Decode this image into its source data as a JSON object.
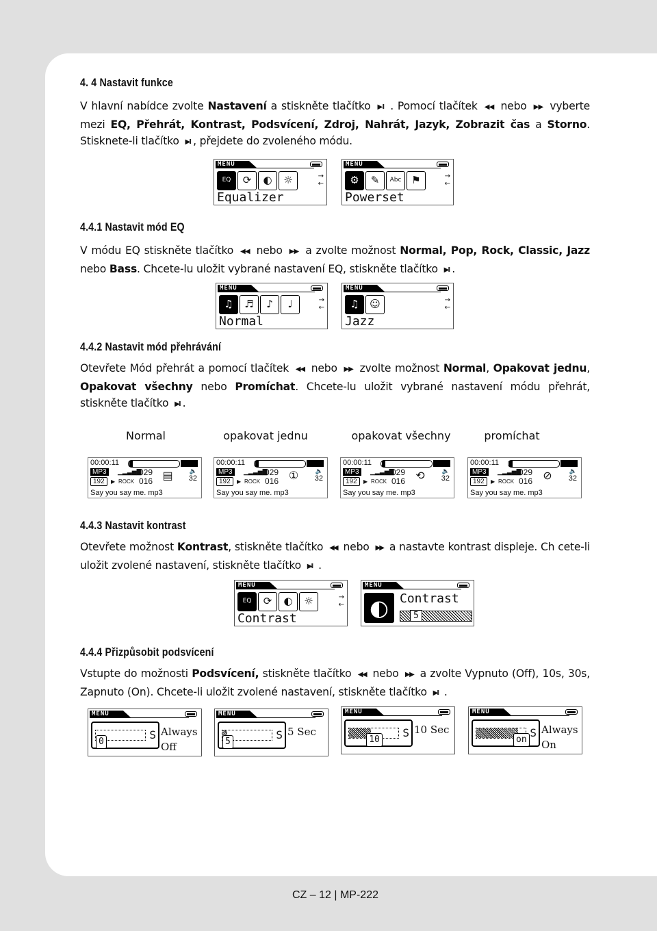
{
  "sections": [
    {
      "id": "s44",
      "heading": "4. 4 Nastavit funkce",
      "paragraph": [
        {
          "t": "V hlavní nabídce zvolte "
        },
        {
          "t": "Nastavení",
          "b": true
        },
        {
          "t": " a stiskněte tlačítko "
        },
        {
          "icon": "play-pause-icon",
          "g": "▶II"
        },
        {
          "t": " . Pomocí tlačítek "
        },
        {
          "icon": "rewind-icon",
          "g": "◀◀"
        },
        {
          "t": " nebo "
        },
        {
          "icon": "fast-forward-icon",
          "g": "▶▶"
        },
        {
          "t": " vyberte mezi "
        },
        {
          "t": "EQ, Přehrát, Kontrast, Podsvícení, Zdroj, Nahrát, Jazyk, Zobrazit čas",
          "b": true
        },
        {
          "t": " a "
        },
        {
          "t": "Storno",
          "b": true
        },
        {
          "t": ". Stisknete-li tlačítko "
        },
        {
          "icon": "play-pause-icon",
          "g": "▶II"
        },
        {
          "t": ", přejdete do zvoleného módu."
        }
      ]
    },
    {
      "id": "s441",
      "heading": "4.4.1 Nastavit mód EQ",
      "paragraph": [
        {
          "t": "V módu EQ stiskněte tlačítko "
        },
        {
          "icon": "rewind-icon",
          "g": "◀◀"
        },
        {
          "t": " nebo "
        },
        {
          "icon": "fast-forward-icon",
          "g": "▶▶"
        },
        {
          "t": " a zvolte možnost "
        },
        {
          "t": "Normal, Pop, Rock, Classic, Jazz",
          "b": true
        },
        {
          "t": " nebo "
        },
        {
          "t": "Bass",
          "b": true
        },
        {
          "t": ". Chcete-lu uložit vybrané nastavení EQ, stiskněte tlačítko "
        },
        {
          "icon": "play-pause-icon",
          "g": "▶II"
        },
        {
          "t": "."
        }
      ]
    },
    {
      "id": "s442",
      "heading": "4.4.2 Nastavit mód přehrávání",
      "paragraph": [
        {
          "t": "Otevřete Mód přehrát a pomocí tlačítek "
        },
        {
          "icon": "rewind-icon",
          "g": "◀◀"
        },
        {
          "t": " nebo "
        },
        {
          "icon": "fast-forward-icon",
          "g": "▶▶"
        },
        {
          "t": " zvolte možnost "
        },
        {
          "t": "Normal",
          "b": true
        },
        {
          "t": ", "
        },
        {
          "t": "Opakovat jednu",
          "b": true
        },
        {
          "t": ", "
        },
        {
          "t": "Opakovat všechny",
          "b": true
        },
        {
          "t": " nebo "
        },
        {
          "t": "Promíchat",
          "b": true
        },
        {
          "t": ". Chcete-lu uložit vybrané nastavení módu přehrát, stiskněte tlačítko "
        },
        {
          "icon": "play-pause-icon",
          "g": "▶II"
        },
        {
          "t": "."
        }
      ]
    },
    {
      "id": "s443",
      "heading": "4.4.3 Nastavit kontrast",
      "paragraph": [
        {
          "t": "Otevřete možnost "
        },
        {
          "t": "Kontrast",
          "b": true
        },
        {
          "t": ", stiskněte tlačítko "
        },
        {
          "icon": "rewind-icon",
          "g": "◀◀"
        },
        {
          "t": " nebo "
        },
        {
          "icon": "fast-forward-icon",
          "g": "▶▶"
        },
        {
          "t": " a nastavte kontrast displeje. Ch cete-li uložit zvolené nastavení, stiskněte tlačítko "
        },
        {
          "icon": "play-pause-icon",
          "g": "▶II"
        },
        {
          "t": " ."
        }
      ]
    },
    {
      "id": "s444",
      "heading": "4.4.4 Přizpůsobit podsvícení",
      "paragraph": [
        {
          "t": "Vstupte do možnosti "
        },
        {
          "t": "Podsvícení,",
          "b": true
        },
        {
          "t": " stiskněte tlačítko "
        },
        {
          "icon": "rewind-icon",
          "g": "◀◀"
        },
        {
          "t": " nebo "
        },
        {
          "icon": "fast-forward-icon",
          "g": "▶▶"
        },
        {
          "t": " a zvolte Vypnuto (Off), 10s, 30s, Zapnuto (On). Chcete-li uložit zvolené nastavení, stiskněte tlačítko "
        },
        {
          "icon": "play-pause-icon",
          "g": "▶II"
        },
        {
          "t": " ."
        }
      ]
    }
  ],
  "menu_screens": [
    {
      "title": "MENU",
      "label": "Equalizer",
      "icons": [
        "EQ",
        "⟳",
        "◐",
        "☼"
      ]
    },
    {
      "title": "MENU",
      "label": "Powerset",
      "icons": [
        "⚙",
        "✎",
        "Abc",
        "⚑"
      ]
    },
    {
      "title": "MENU",
      "label": "Normal",
      "icons": [
        "♫",
        "♬",
        "♪",
        "♩"
      ]
    },
    {
      "title": "MENU",
      "label": "Jazz",
      "icons": [
        "♫",
        "☺"
      ]
    },
    {
      "title": "MENU",
      "label": "Contrast",
      "icons": [
        "EQ",
        "⟳",
        "◐",
        "☼"
      ]
    }
  ],
  "contrast_screen": {
    "title": "MENU",
    "label": "Contrast",
    "value": "5"
  },
  "play_modes": {
    "labels": [
      "Normal",
      "opakovat jednu",
      "opakovat všechny",
      "promíchat"
    ],
    "player": {
      "time": "00:00:11",
      "format": "MP3",
      "bitrate": "192",
      "eq": "ROCK",
      "track": "029",
      "total": "016",
      "volume": "32",
      "song": "Say you say me. mp3"
    },
    "mode_icons": [
      "normal-mode-icon",
      "repeat-one-icon",
      "repeat-all-icon",
      "shuffle-icon"
    ],
    "mode_glyphs": [
      "▤",
      "①",
      "⟲",
      "⊘"
    ]
  },
  "backlight_screens": [
    {
      "title": "MENU",
      "value": "0",
      "unit": "S",
      "text1": "Always",
      "text2": "Off",
      "level": 0
    },
    {
      "title": "MENU",
      "value": "5",
      "unit": "S",
      "text1": "5 Sec",
      "text2": "",
      "level": 0.1
    },
    {
      "title": "MENU",
      "value": "10",
      "unit": "S",
      "text1": "10 Sec",
      "text2": "",
      "level": 0.45
    },
    {
      "title": "MENU",
      "value": "on",
      "unit": "S",
      "text1": "Always",
      "text2": "On",
      "level": 0.85
    }
  ],
  "footer": {
    "left": "CZ – 12 |",
    "right": "MP-222"
  }
}
